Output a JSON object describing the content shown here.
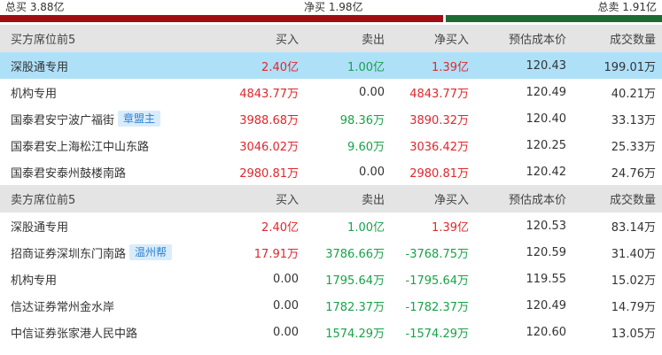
{
  "summary": {
    "total_buy": "总买 3.88亿",
    "net_buy": "净买 1.98亿",
    "total_sell": "总卖 1.91亿",
    "buy_fraction": 0.67
  },
  "colors": {
    "buy_bar": "#a00d12",
    "sell_bar": "#1d6b32",
    "up": "#e0272c",
    "down": "#18a24a",
    "highlight": "#aee0f8"
  },
  "buy_section": {
    "headers": [
      "买方席位前5",
      "买入",
      "卖出",
      "净买入",
      "预估成本价",
      "成交数量"
    ],
    "rows": [
      {
        "name": "深股通专用",
        "tag": "",
        "buy": "2.40亿",
        "sell": "1.00亿",
        "net": "1.39亿",
        "cost": "120.43",
        "volume": "199.01万",
        "highlight": true
      },
      {
        "name": "机构专用",
        "tag": "",
        "buy": "4843.77万",
        "sell": "0.00",
        "net": "4843.77万",
        "cost": "120.49",
        "volume": "40.21万"
      },
      {
        "name": "国泰君安宁波广福街",
        "tag": "章盟主",
        "buy": "3988.68万",
        "sell": "98.36万",
        "net": "3890.32万",
        "cost": "120.40",
        "volume": "33.13万"
      },
      {
        "name": "国泰君安上海松江中山东路",
        "tag": "",
        "buy": "3046.02万",
        "sell": "9.60万",
        "net": "3036.42万",
        "cost": "120.25",
        "volume": "25.33万"
      },
      {
        "name": "国泰君安泰州鼓楼南路",
        "tag": "",
        "buy": "2980.81万",
        "sell": "0.00",
        "net": "2980.81万",
        "cost": "120.42",
        "volume": "24.76万"
      }
    ]
  },
  "sell_section": {
    "headers": [
      "卖方席位前5",
      "买入",
      "卖出",
      "净买入",
      "预估成本价",
      "成交数量"
    ],
    "rows": [
      {
        "name": "深股通专用",
        "tag": "",
        "buy": "2.40亿",
        "sell": "1.00亿",
        "net": "1.39亿",
        "cost": "120.53",
        "volume": "83.14万"
      },
      {
        "name": "招商证券深圳东门南路",
        "tag": "温州帮",
        "buy": "17.91万",
        "sell": "3786.66万",
        "net": "-3768.75万",
        "cost": "120.59",
        "volume": "31.40万"
      },
      {
        "name": "机构专用",
        "tag": "",
        "buy": "0.00",
        "sell": "1795.64万",
        "net": "-1795.64万",
        "cost": "119.55",
        "volume": "15.02万"
      },
      {
        "name": "信达证券常州金水岸",
        "tag": "",
        "buy": "0.00",
        "sell": "1782.37万",
        "net": "-1782.37万",
        "cost": "120.49",
        "volume": "14.79万"
      },
      {
        "name": "中信证券张家港人民中路",
        "tag": "",
        "buy": "0.00",
        "sell": "1574.29万",
        "net": "-1574.29万",
        "cost": "120.60",
        "volume": "13.05万"
      }
    ]
  }
}
